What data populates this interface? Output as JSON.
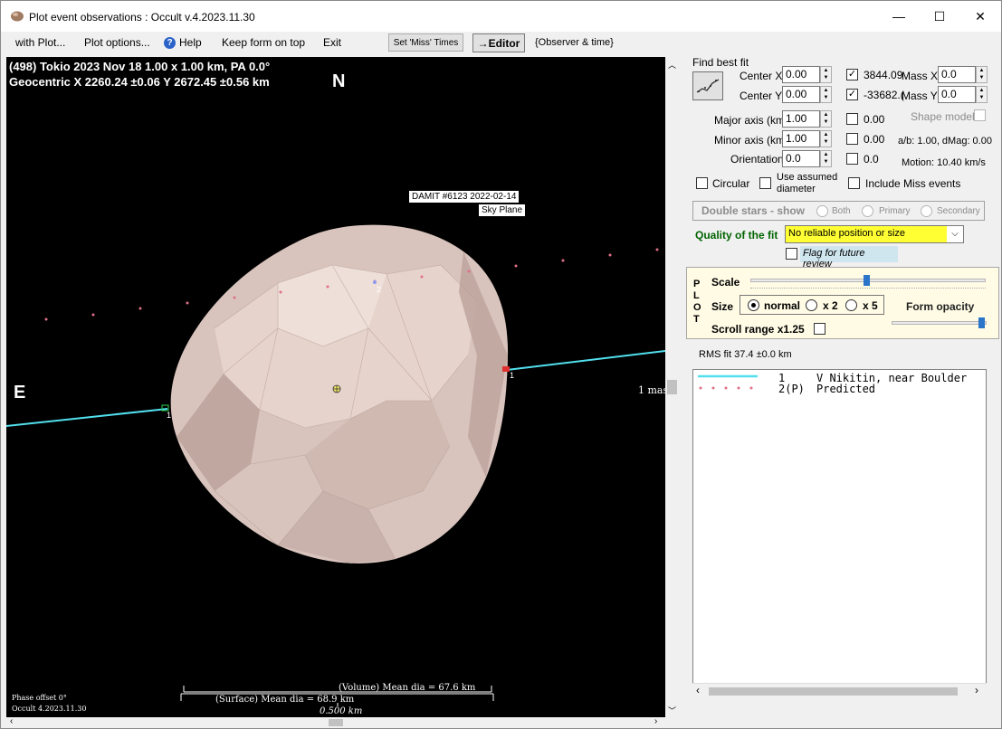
{
  "window": {
    "title": "Plot event observations : Occult v.4.2023.11.30",
    "controls": {
      "minimize": "—",
      "maximize": "☐",
      "close": "✕"
    }
  },
  "menu": {
    "items": [
      "with Plot...",
      "Plot options...",
      "Help",
      "Keep form on top",
      "Exit"
    ],
    "set_miss_times": "Set 'Miss' Times",
    "editor": "→Editor",
    "observer_time": "{Observer & time}"
  },
  "plot": {
    "header_line1": "(498) Tokio  2023 Nov 18   1.00 x 1.00 km, PA 0.0°",
    "header_line2": "Geocentric  X  2260.24 ±0.06  Y 2672.45 ±0.56 km",
    "north": "N",
    "east": "E",
    "damit_label": "DAMIT #6123 2022-02-14",
    "sky_plane": "Sky Plane",
    "scale_mas": "1 mas",
    "chord_label_1": "1",
    "chord_label_right": "1",
    "predicted_label": "2",
    "volume_dia": "(Volume) Mean dia = 67.6 km",
    "surface_dia": "(Surface) Mean dia = 68.9 km",
    "scale_km": "0.500 km",
    "phase_offset": "Phase offset 0°",
    "version": "Occult 4.2023.11.30",
    "colors": {
      "chord": "#52e0ef",
      "predicted": "#e0708a",
      "asteroid": "#d9c4bd"
    }
  },
  "fit": {
    "section_title": "Find best fit",
    "center_x_label": "Center X",
    "center_x_value": "0.00",
    "center_y_label": "Center Y",
    "center_y_value": "0.00",
    "mass_x_check_value": "3844.09",
    "mass_x_label": "Mass X",
    "mass_x_value": "0.0",
    "mass_y_check_value": "-33682.(",
    "mass_y_label": "Mass Y",
    "mass_y_value": "0.0",
    "major_axis_label": "Major axis (km)",
    "major_axis_value": "1.00",
    "major_check_value": "0.00",
    "shape_model_label": "Shape model",
    "minor_axis_label": "Minor axis (km)",
    "minor_axis_value": "1.00",
    "minor_check_value": "0.00",
    "ab_dmag": "a/b: 1.00, dMag: 0.00",
    "orientation_label": "Orientation",
    "orientation_value": "0.0",
    "orientation_check_value": "0.0",
    "motion": "Motion: 10.40 km/s",
    "circular_label": "Circular",
    "use_assumed_label_1": "Use assumed",
    "use_assumed_label_2": "diameter",
    "include_miss_label": "Include Miss events",
    "double_stars_label": "Double stars - show",
    "both_label": "Both",
    "primary_label": "Primary",
    "secondary_label": "Secondary",
    "quality_label": "Quality of the fit",
    "quality_value": "No reliable position or size",
    "flag_review_label": "Flag for future review"
  },
  "plot_panel": {
    "vertical_letters": [
      "P",
      "L",
      "O",
      "T"
    ],
    "scale_label": "Scale",
    "size_label": "Size",
    "size_normal": "normal",
    "size_x2": "x 2",
    "size_x5": "x 5",
    "form_opacity_label": "Form opacity",
    "scroll_range_label": "Scroll range x1.25"
  },
  "rms_fit": "RMS fit 37.4 ±0.0 km",
  "legend": {
    "rows": [
      {
        "id": "1",
        "text": "V Nikitin, near Boulder"
      },
      {
        "id": "2(P)",
        "text": "Predicted"
      }
    ]
  }
}
